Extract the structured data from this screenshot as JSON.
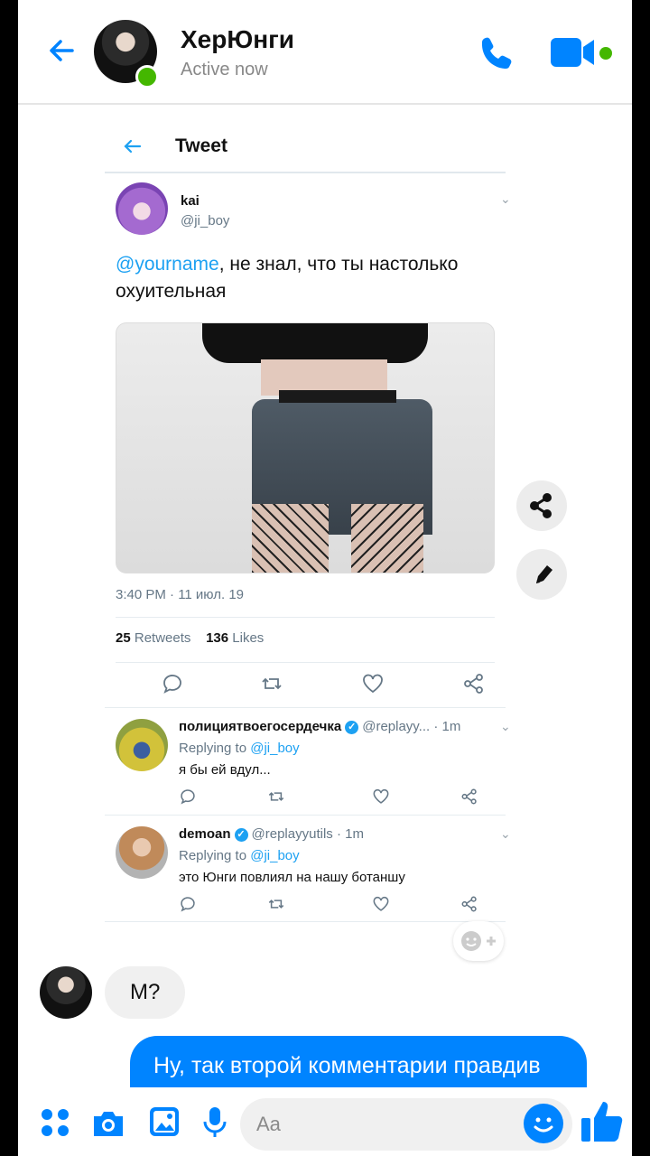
{
  "header": {
    "name": "ХерЮнги",
    "status": "Active now"
  },
  "tweet": {
    "title": "Tweet",
    "author_name": "kai",
    "author_handle": "@ji_boy",
    "mention": "@yourname",
    "text_rest": ", не знал, что ты настолько охуительная",
    "time": "3:40 PM · 11 июл. 19",
    "retweets_count": "25",
    "retweets_label": "Retweets",
    "likes_count": "136",
    "likes_label": "Likes"
  },
  "replies": [
    {
      "name": "полициятвоегосердечка",
      "meta": "@replayy... · 1m",
      "replying": "Replying to",
      "replying_handle": "@ji_boy",
      "text": "я бы ей вдул..."
    },
    {
      "name": "demoan",
      "meta": "@replayyutils · 1m",
      "replying": "Replying to",
      "replying_handle": "@ji_boy",
      "text": "это Юнги повлиял на нашу ботаншу"
    }
  ],
  "messages": {
    "incoming": "М?",
    "outgoing": "Ну, так второй комментарии правдив"
  },
  "composer": {
    "placeholder": "Aa"
  },
  "colors": {
    "accent": "#0084ff",
    "twitter": "#1da1f2",
    "online": "#44b700"
  },
  "icons": [
    "back-arrow-icon",
    "phone-icon",
    "video-icon",
    "share-icon",
    "pencil-icon",
    "reply-icon",
    "retweet-icon",
    "heart-icon",
    "share-tweet-icon",
    "chevron-down-icon",
    "verified-icon",
    "apps-icon",
    "camera-icon",
    "image-icon",
    "mic-icon",
    "emoji-icon",
    "thumbs-up-icon",
    "emoji-add-icon"
  ]
}
